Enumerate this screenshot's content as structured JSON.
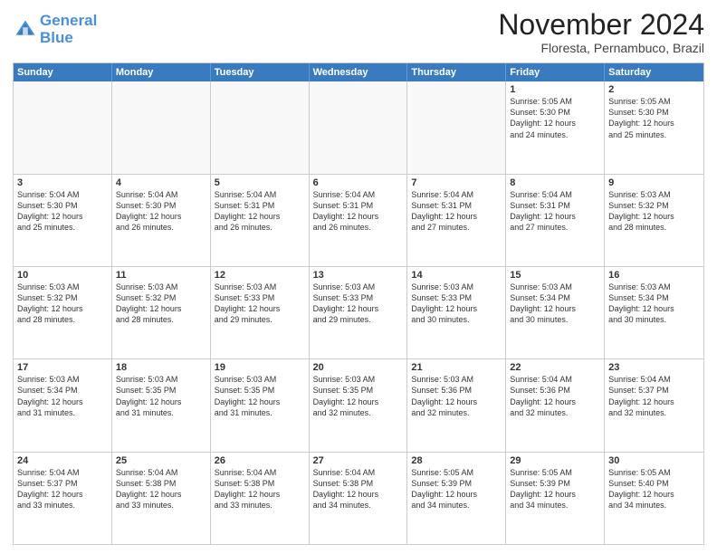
{
  "logo": {
    "line1": "General",
    "line2": "Blue"
  },
  "header": {
    "month_year": "November 2024",
    "location": "Floresta, Pernambuco, Brazil"
  },
  "days_of_week": [
    "Sunday",
    "Monday",
    "Tuesday",
    "Wednesday",
    "Thursday",
    "Friday",
    "Saturday"
  ],
  "rows": [
    [
      {
        "day": "",
        "info": "",
        "empty": true
      },
      {
        "day": "",
        "info": "",
        "empty": true
      },
      {
        "day": "",
        "info": "",
        "empty": true
      },
      {
        "day": "",
        "info": "",
        "empty": true
      },
      {
        "day": "",
        "info": "",
        "empty": true
      },
      {
        "day": "1",
        "info": "Sunrise: 5:05 AM\nSunset: 5:30 PM\nDaylight: 12 hours\nand 24 minutes.",
        "empty": false
      },
      {
        "day": "2",
        "info": "Sunrise: 5:05 AM\nSunset: 5:30 PM\nDaylight: 12 hours\nand 25 minutes.",
        "empty": false
      }
    ],
    [
      {
        "day": "3",
        "info": "Sunrise: 5:04 AM\nSunset: 5:30 PM\nDaylight: 12 hours\nand 25 minutes.",
        "empty": false
      },
      {
        "day": "4",
        "info": "Sunrise: 5:04 AM\nSunset: 5:30 PM\nDaylight: 12 hours\nand 26 minutes.",
        "empty": false
      },
      {
        "day": "5",
        "info": "Sunrise: 5:04 AM\nSunset: 5:31 PM\nDaylight: 12 hours\nand 26 minutes.",
        "empty": false
      },
      {
        "day": "6",
        "info": "Sunrise: 5:04 AM\nSunset: 5:31 PM\nDaylight: 12 hours\nand 26 minutes.",
        "empty": false
      },
      {
        "day": "7",
        "info": "Sunrise: 5:04 AM\nSunset: 5:31 PM\nDaylight: 12 hours\nand 27 minutes.",
        "empty": false
      },
      {
        "day": "8",
        "info": "Sunrise: 5:04 AM\nSunset: 5:31 PM\nDaylight: 12 hours\nand 27 minutes.",
        "empty": false
      },
      {
        "day": "9",
        "info": "Sunrise: 5:03 AM\nSunset: 5:32 PM\nDaylight: 12 hours\nand 28 minutes.",
        "empty": false
      }
    ],
    [
      {
        "day": "10",
        "info": "Sunrise: 5:03 AM\nSunset: 5:32 PM\nDaylight: 12 hours\nand 28 minutes.",
        "empty": false
      },
      {
        "day": "11",
        "info": "Sunrise: 5:03 AM\nSunset: 5:32 PM\nDaylight: 12 hours\nand 28 minutes.",
        "empty": false
      },
      {
        "day": "12",
        "info": "Sunrise: 5:03 AM\nSunset: 5:33 PM\nDaylight: 12 hours\nand 29 minutes.",
        "empty": false
      },
      {
        "day": "13",
        "info": "Sunrise: 5:03 AM\nSunset: 5:33 PM\nDaylight: 12 hours\nand 29 minutes.",
        "empty": false
      },
      {
        "day": "14",
        "info": "Sunrise: 5:03 AM\nSunset: 5:33 PM\nDaylight: 12 hours\nand 30 minutes.",
        "empty": false
      },
      {
        "day": "15",
        "info": "Sunrise: 5:03 AM\nSunset: 5:34 PM\nDaylight: 12 hours\nand 30 minutes.",
        "empty": false
      },
      {
        "day": "16",
        "info": "Sunrise: 5:03 AM\nSunset: 5:34 PM\nDaylight: 12 hours\nand 30 minutes.",
        "empty": false
      }
    ],
    [
      {
        "day": "17",
        "info": "Sunrise: 5:03 AM\nSunset: 5:34 PM\nDaylight: 12 hours\nand 31 minutes.",
        "empty": false
      },
      {
        "day": "18",
        "info": "Sunrise: 5:03 AM\nSunset: 5:35 PM\nDaylight: 12 hours\nand 31 minutes.",
        "empty": false
      },
      {
        "day": "19",
        "info": "Sunrise: 5:03 AM\nSunset: 5:35 PM\nDaylight: 12 hours\nand 31 minutes.",
        "empty": false
      },
      {
        "day": "20",
        "info": "Sunrise: 5:03 AM\nSunset: 5:35 PM\nDaylight: 12 hours\nand 32 minutes.",
        "empty": false
      },
      {
        "day": "21",
        "info": "Sunrise: 5:03 AM\nSunset: 5:36 PM\nDaylight: 12 hours\nand 32 minutes.",
        "empty": false
      },
      {
        "day": "22",
        "info": "Sunrise: 5:04 AM\nSunset: 5:36 PM\nDaylight: 12 hours\nand 32 minutes.",
        "empty": false
      },
      {
        "day": "23",
        "info": "Sunrise: 5:04 AM\nSunset: 5:37 PM\nDaylight: 12 hours\nand 32 minutes.",
        "empty": false
      }
    ],
    [
      {
        "day": "24",
        "info": "Sunrise: 5:04 AM\nSunset: 5:37 PM\nDaylight: 12 hours\nand 33 minutes.",
        "empty": false
      },
      {
        "day": "25",
        "info": "Sunrise: 5:04 AM\nSunset: 5:38 PM\nDaylight: 12 hours\nand 33 minutes.",
        "empty": false
      },
      {
        "day": "26",
        "info": "Sunrise: 5:04 AM\nSunset: 5:38 PM\nDaylight: 12 hours\nand 33 minutes.",
        "empty": false
      },
      {
        "day": "27",
        "info": "Sunrise: 5:04 AM\nSunset: 5:38 PM\nDaylight: 12 hours\nand 34 minutes.",
        "empty": false
      },
      {
        "day": "28",
        "info": "Sunrise: 5:05 AM\nSunset: 5:39 PM\nDaylight: 12 hours\nand 34 minutes.",
        "empty": false
      },
      {
        "day": "29",
        "info": "Sunrise: 5:05 AM\nSunset: 5:39 PM\nDaylight: 12 hours\nand 34 minutes.",
        "empty": false
      },
      {
        "day": "30",
        "info": "Sunrise: 5:05 AM\nSunset: 5:40 PM\nDaylight: 12 hours\nand 34 minutes.",
        "empty": false
      }
    ]
  ]
}
